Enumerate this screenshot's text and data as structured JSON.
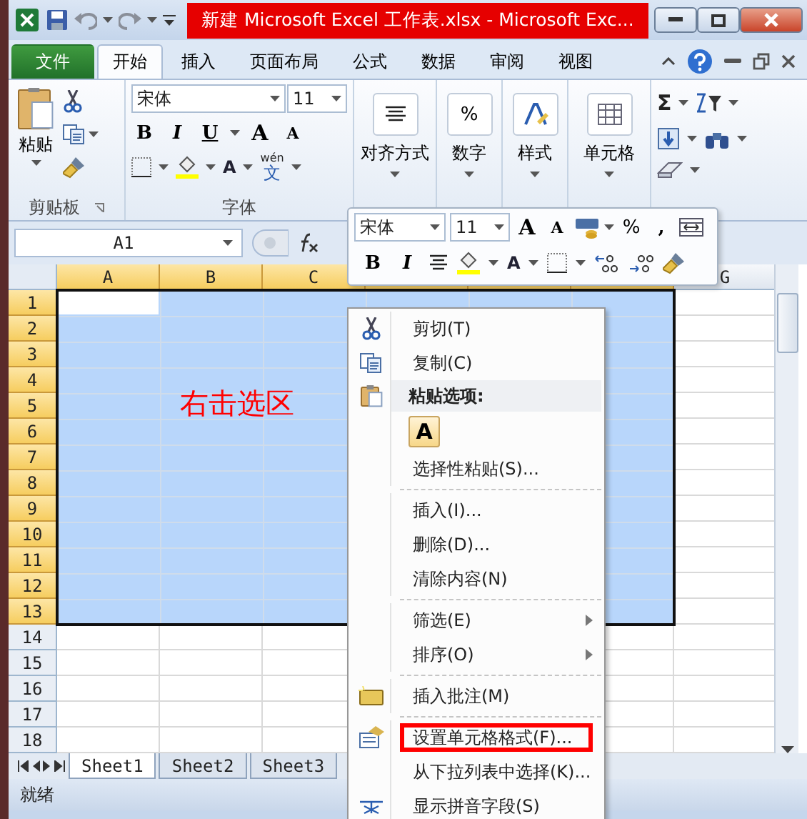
{
  "window": {
    "title": "新建 Microsoft Excel 工作表.xlsx  -  Microsoft Exc..."
  },
  "ribbon_tabs": [
    {
      "label": "文件",
      "kind": "file",
      "selected": false
    },
    {
      "label": "开始",
      "kind": "tab",
      "selected": true
    },
    {
      "label": "插入",
      "kind": "tab",
      "selected": false
    },
    {
      "label": "页面布局",
      "kind": "tab",
      "selected": false
    },
    {
      "label": "公式",
      "kind": "tab",
      "selected": false
    },
    {
      "label": "数据",
      "kind": "tab",
      "selected": false
    },
    {
      "label": "审阅",
      "kind": "tab",
      "selected": false
    },
    {
      "label": "视图",
      "kind": "tab",
      "selected": false
    }
  ],
  "clipboard_group": {
    "paste": "粘贴",
    "label": "剪贴板"
  },
  "font_group": {
    "font_name": "宋体",
    "font_size": "11",
    "bold": "B",
    "italic": "I",
    "underline": "U",
    "grow": "A",
    "shrink": "A",
    "font_color": "A",
    "phonetic_top": "wén",
    "phonetic_char": "文",
    "label": "字体"
  },
  "big_buttons": [
    {
      "label": "对齐方式",
      "kind": "align"
    },
    {
      "label": "数字",
      "kind": "number",
      "symbol": "%"
    },
    {
      "label": "样式",
      "kind": "styles"
    },
    {
      "label": "单元格",
      "kind": "cells"
    }
  ],
  "edit_group": {
    "sum": "Σ"
  },
  "formula_bar": {
    "name_box": "A1"
  },
  "columns": [
    {
      "label": "A",
      "selected": true
    },
    {
      "label": "B",
      "selected": true
    },
    {
      "label": "C",
      "selected": true
    },
    {
      "selected": true
    },
    {
      "selected": true
    },
    {
      "selected": true
    },
    {
      "label": "G",
      "selected": false
    }
  ],
  "rows": [
    {
      "label": "1",
      "selected": true
    },
    {
      "label": "2",
      "selected": true
    },
    {
      "label": "3",
      "selected": true
    },
    {
      "label": "4",
      "selected": true
    },
    {
      "label": "5",
      "selected": true
    },
    {
      "label": "6",
      "selected": true
    },
    {
      "label": "7",
      "selected": true
    },
    {
      "label": "8",
      "selected": true
    },
    {
      "label": "9",
      "selected": true
    },
    {
      "label": "10",
      "selected": true
    },
    {
      "label": "11",
      "selected": true
    },
    {
      "label": "12",
      "selected": true
    },
    {
      "label": "13",
      "selected": true
    },
    {
      "label": "14",
      "selected": false
    },
    {
      "label": "15",
      "selected": false
    },
    {
      "label": "16",
      "selected": false
    },
    {
      "label": "17",
      "selected": false
    },
    {
      "label": "18",
      "selected": false
    }
  ],
  "annotation": "右击选区",
  "mini_toolbar": {
    "font_name": "宋体",
    "font_size": "11",
    "grow": "A",
    "shrink": "A",
    "percent": "%",
    "comma": ",",
    "bold": "B",
    "italic": "I",
    "font_color": "A"
  },
  "context_menu": [
    {
      "kind": "item",
      "label": "剪切(T)",
      "submenu": false,
      "highlighted": false
    },
    {
      "kind": "item",
      "label": "复制(C)",
      "submenu": false,
      "highlighted": false
    },
    {
      "kind": "header",
      "label": "粘贴选项:"
    },
    {
      "kind": "paste-options",
      "label": "A"
    },
    {
      "kind": "item",
      "label": "选择性粘贴(S)...",
      "submenu": false,
      "highlighted": false
    },
    {
      "kind": "separator"
    },
    {
      "kind": "item",
      "label": "插入(I)...",
      "submenu": false,
      "highlighted": false
    },
    {
      "kind": "item",
      "label": "删除(D)...",
      "submenu": false,
      "highlighted": false
    },
    {
      "kind": "item",
      "label": "清除内容(N)",
      "submenu": false,
      "highlighted": false
    },
    {
      "kind": "separator"
    },
    {
      "kind": "item",
      "label": "筛选(E)",
      "submenu": true,
      "highlighted": false
    },
    {
      "kind": "item",
      "label": "排序(O)",
      "submenu": true,
      "highlighted": false
    },
    {
      "kind": "separator"
    },
    {
      "kind": "item",
      "label": "插入批注(M)",
      "submenu": false,
      "highlighted": false
    },
    {
      "kind": "separator"
    },
    {
      "kind": "item",
      "label": "设置单元格格式(F)...",
      "submenu": false,
      "highlighted": true
    },
    {
      "kind": "item",
      "label": "从下拉列表中选择(K)...",
      "submenu": false,
      "highlighted": false
    },
    {
      "kind": "item",
      "label": "显示拼音字段(S)",
      "submenu": false,
      "highlighted": false
    }
  ],
  "sheet_tabs": [
    {
      "label": "Sheet1",
      "selected": true
    },
    {
      "label": "Sheet2",
      "selected": false
    },
    {
      "label": "Sheet3",
      "selected": false
    }
  ],
  "status_bar": {
    "text": "就绪"
  }
}
